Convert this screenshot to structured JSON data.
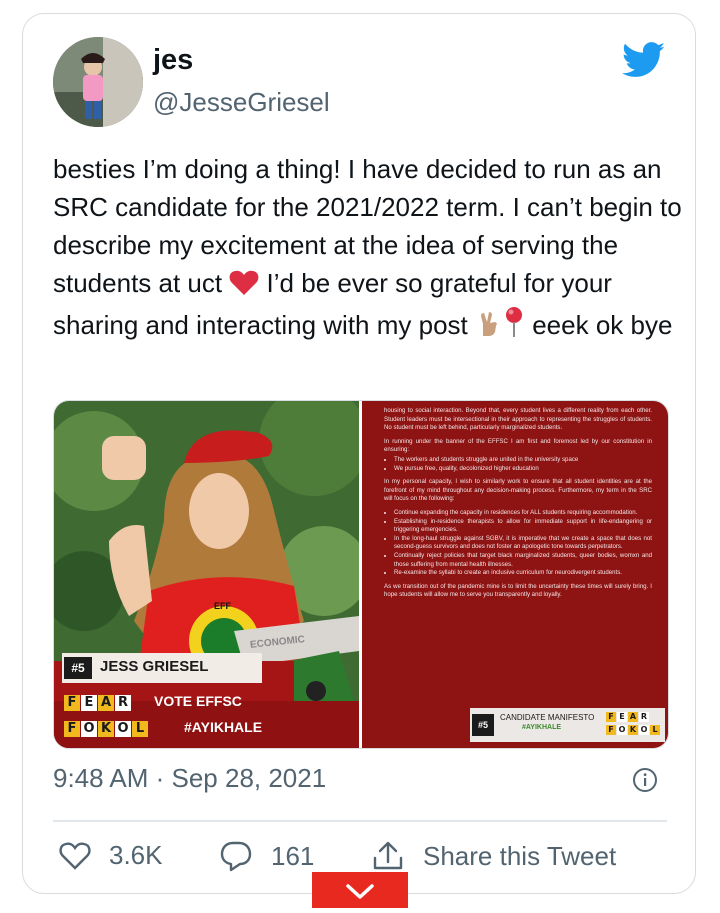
{
  "author": {
    "name": "jes",
    "handle": "@JesseGriesel"
  },
  "tweet": {
    "line1": "besties I’m doing a thing! I have decided to run as an SRC candidate for the 2021/2022 term. I can’t begin to describe my excitement at the idea of serving the students at uct ",
    "line2": " I’d be ever so grateful for your sharing and interacting with my post ",
    "line3": " eeek ok bye",
    "timestamp": "9:48 AM · Sep 28, 2021"
  },
  "poster": {
    "number": "#5",
    "candidate_name": "JESS GRIESEL",
    "vote_text": "VOTE EFFSC",
    "hashtag": "#AYIKHALE",
    "fear_letters": [
      "F",
      "E",
      "A",
      "R"
    ],
    "fokol_letters": [
      "F",
      "O",
      "K",
      "O",
      "L"
    ],
    "shirt_text": "EFF",
    "banner_text": "ECONOMIC"
  },
  "manifesto": {
    "p1": "housing to social interaction. Beyond that, every student lives a different reality from each other. Student leaders must be intersectional in their approach to representing the struggles of students. No student must be left behind, particularly marginalized students.",
    "p2": "In running under the banner of the EFFSC I am first and foremost led by our constitution in ensuring:",
    "p2_bullets": [
      "The workers and students struggle are united in the university space",
      "We pursue free, quality, decolonized higher education"
    ],
    "p3": "In my personal capacity, I wish to similarly work to ensure that all student identities are at the forefront of my mind throughout any decision-making process. Furthermore, my term in the SRC will focus on the following:",
    "p3_bullets": [
      "Continue expanding the capacity in residences for ALL students requiring accommodation.",
      "Establishing in-residence therapists to allow for immediate support in life-endangering or triggering emergencies.",
      "In the long-haul struggle against SGBV, it is imperative that we create a space that does not second-guess survivors and does not foster an apologetic tone towards perpetrators.",
      "Continually reject policies that target black marginalized students, queer bodies, womxn and those suffering from mental health illnesses.",
      "Re-examine the syllabi to create an inclusive curriculum for neurodivergent students."
    ],
    "p4": "As we transition out of the pandemic mine is to limit the uncertainty these times will surely bring. I hope students will allow me to serve you transparently and loyally.",
    "footer_number": "#5",
    "footer_title": "CANDIDATE MANIFESTO",
    "footer_hashtag": "#AYIKHALE"
  },
  "actions": {
    "likes": "3.6K",
    "replies": "161",
    "share_label": "Share this Tweet"
  },
  "colors": {
    "twitter_blue": "#1d9bf0",
    "heart_red": "#e0245e",
    "poster_red": "#8e1313",
    "fear_yellow": "#f1b91e",
    "scroll_button": "#e8291f"
  },
  "icons": {
    "bird": "twitter-bird-icon",
    "info": "info-icon",
    "like": "heart-icon",
    "reply": "speech-bubble-icon",
    "share": "share-icon",
    "scroll": "chevron-down-icon"
  }
}
